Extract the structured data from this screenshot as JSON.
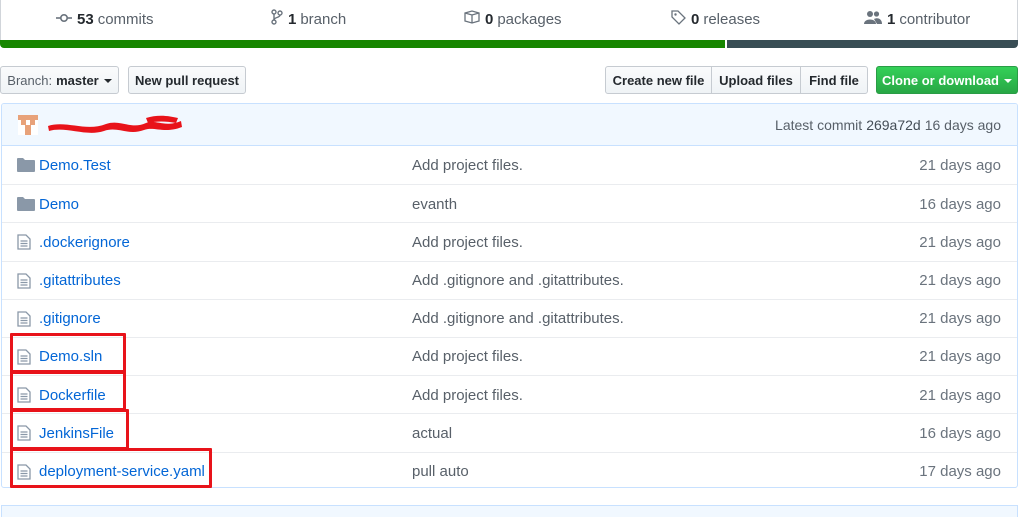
{
  "summary": {
    "commits": {
      "count": "53",
      "label": "commits",
      "icon": "history-icon"
    },
    "branch": {
      "count": "1",
      "label": "branch",
      "icon": "git-branch-icon"
    },
    "packages": {
      "count": "0",
      "label": "packages",
      "icon": "package-icon"
    },
    "releases": {
      "count": "0",
      "label": "releases",
      "icon": "tag-icon"
    },
    "contributor": {
      "count": "1",
      "label": "contributor",
      "icon": "people-icon"
    }
  },
  "languages": [
    {
      "share": 0.714,
      "color": "#178600"
    },
    {
      "share": 0.286,
      "color": "#384d54"
    }
  ],
  "toolbar": {
    "branch_prefix": "Branch:",
    "branch_value": "master",
    "new_pull_request": "New pull request",
    "create_new_file": "Create new file",
    "upload_files": "Upload files",
    "find_file": "Find file",
    "clone_or_download": "Clone or download"
  },
  "commit_bar": {
    "latest_prefix": "Latest commit",
    "sha": "269a72d",
    "age": "16 days ago"
  },
  "files": [
    {
      "type": "folder",
      "name": "Demo.Test",
      "message": "Add project files.",
      "age": "21 days ago",
      "highlighted": false
    },
    {
      "type": "folder",
      "name": "Demo",
      "message": "evanth",
      "age": "16 days ago",
      "highlighted": false
    },
    {
      "type": "file",
      "name": ".dockerignore",
      "message": "Add project files.",
      "age": "21 days ago",
      "highlighted": false
    },
    {
      "type": "file",
      "name": ".gitattributes",
      "message": "Add .gitignore and .gitattributes.",
      "age": "21 days ago",
      "highlighted": false
    },
    {
      "type": "file",
      "name": ".gitignore",
      "message": "Add .gitignore and .gitattributes.",
      "age": "21 days ago",
      "highlighted": false
    },
    {
      "type": "file",
      "name": "Demo.sln",
      "message": "Add project files.",
      "age": "21 days ago",
      "highlighted": true
    },
    {
      "type": "file",
      "name": "Dockerfile",
      "message": "Add project files.",
      "age": "21 days ago",
      "highlighted": true
    },
    {
      "type": "file",
      "name": "JenkinsFile",
      "message": "actual",
      "age": "16 days ago",
      "highlighted": true
    },
    {
      "type": "file",
      "name": "deployment-service.yaml",
      "message": "pull auto",
      "age": "17 days ago",
      "highlighted": true
    }
  ],
  "colors": {
    "link": "#0366d6",
    "highlight_box": "#e8131a",
    "clone_button": "#28a745",
    "commit_bar_bg": "#f1f8ff"
  }
}
